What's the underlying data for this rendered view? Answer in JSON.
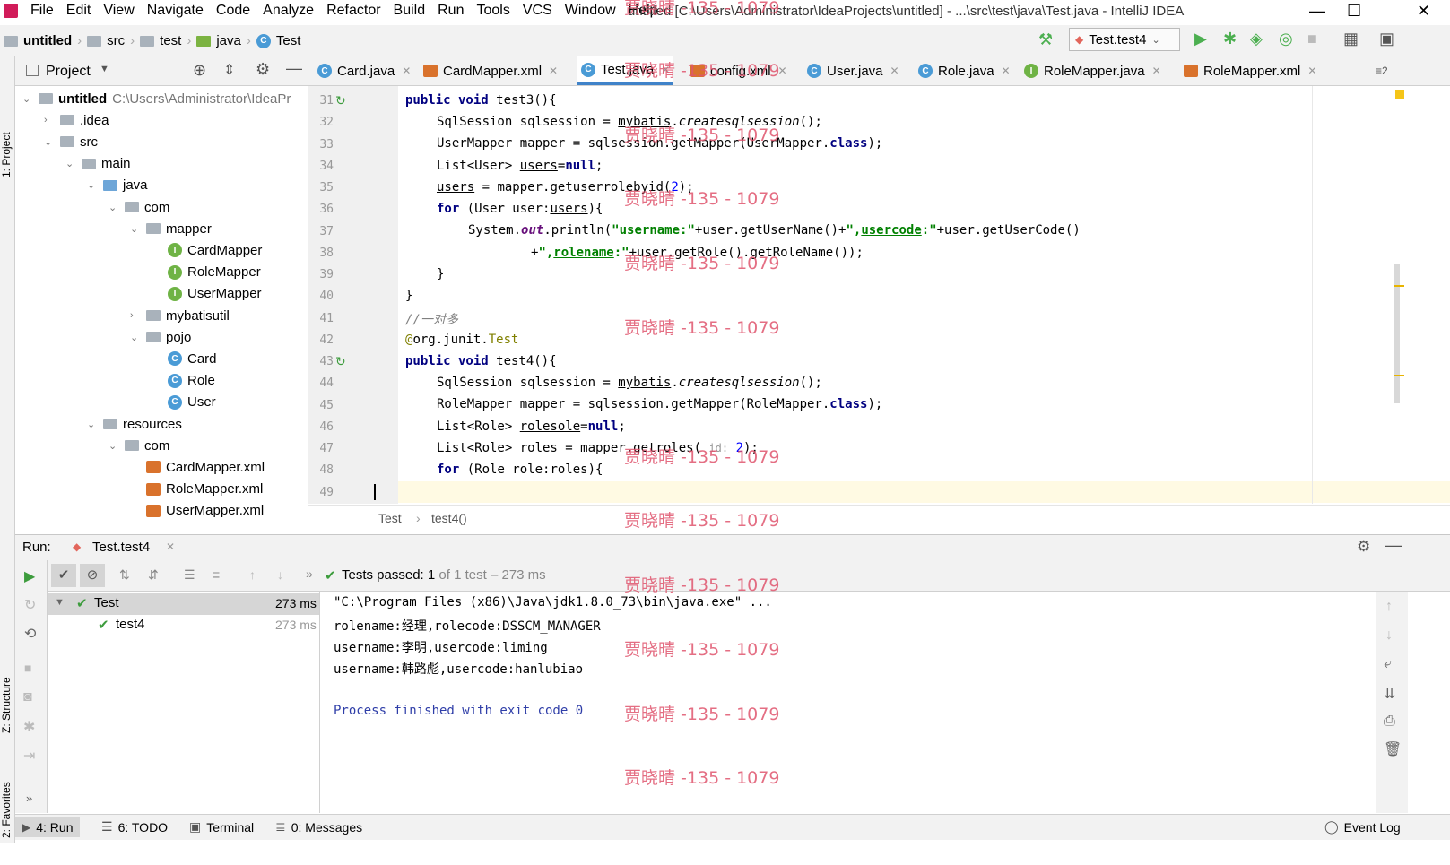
{
  "menubar": {
    "items": [
      "File",
      "Edit",
      "View",
      "Navigate",
      "Code",
      "Analyze",
      "Refactor",
      "Build",
      "Run",
      "Tools",
      "VCS",
      "Window",
      "Help"
    ],
    "title": "untitled [C:\\Users\\Administrator\\IdeaProjects\\untitled] - ...\\src\\test\\java\\Test.java - IntelliJ IDEA"
  },
  "navbar": {
    "crumbs": [
      "untitled",
      "src",
      "test",
      "java",
      "Test"
    ],
    "run_config": "Test.test4"
  },
  "left_strip": {
    "project": "1: Project",
    "structure": "Z: Structure",
    "favorites": "2: Favorites"
  },
  "project": {
    "header": "Project",
    "tree": [
      {
        "label": "untitled",
        "extra": "C:\\Users\\Administrator\\IdeaPr",
        "icon": "folder",
        "depth": 0,
        "expanded": true
      },
      {
        "label": ".idea",
        "icon": "folder",
        "depth": 1,
        "expanded": false
      },
      {
        "label": "src",
        "icon": "folder",
        "depth": 1,
        "expanded": true
      },
      {
        "label": "main",
        "icon": "folder",
        "depth": 2,
        "expanded": true
      },
      {
        "label": "java",
        "icon": "folderb",
        "depth": 3,
        "expanded": true
      },
      {
        "label": "com",
        "icon": "folder",
        "depth": 4,
        "expanded": true
      },
      {
        "label": "mapper",
        "icon": "folder",
        "depth": 5,
        "expanded": true
      },
      {
        "label": "CardMapper",
        "icon": "interface",
        "depth": 6
      },
      {
        "label": "RoleMapper",
        "icon": "interface",
        "depth": 6
      },
      {
        "label": "UserMapper",
        "icon": "interface",
        "depth": 6
      },
      {
        "label": "mybatisutil",
        "icon": "folder",
        "depth": 5,
        "expanded": false
      },
      {
        "label": "pojo",
        "icon": "folder",
        "depth": 5,
        "expanded": true
      },
      {
        "label": "Card",
        "icon": "class",
        "depth": 6
      },
      {
        "label": "Role",
        "icon": "class",
        "depth": 6
      },
      {
        "label": "User",
        "icon": "class",
        "depth": 6
      },
      {
        "label": "resources",
        "icon": "folder",
        "depth": 3,
        "expanded": true
      },
      {
        "label": "com",
        "icon": "folder",
        "depth": 4,
        "expanded": true
      },
      {
        "label": "CardMapper.xml",
        "icon": "xml",
        "depth": 5
      },
      {
        "label": "RoleMapper.xml",
        "icon": "xml",
        "depth": 5
      },
      {
        "label": "UserMapper.xml",
        "icon": "xml",
        "depth": 5
      }
    ]
  },
  "tabs": [
    {
      "label": "Card.java",
      "icon": "class"
    },
    {
      "label": "CardMapper.xml",
      "icon": "xml"
    },
    {
      "label": "Test.java",
      "icon": "class",
      "active": true
    },
    {
      "label": "config.xml",
      "icon": "xml"
    },
    {
      "label": "User.java",
      "icon": "class"
    },
    {
      "label": "Role.java",
      "icon": "class"
    },
    {
      "label": "RoleMapper.java",
      "icon": "interface"
    },
    {
      "label": "RoleMapper.xml",
      "icon": "xml"
    }
  ],
  "tabs_overflow": "≡2",
  "editor": {
    "line_numbers": [
      "31",
      "32",
      "33",
      "34",
      "35",
      "36",
      "37",
      "38",
      "39",
      "40",
      "41",
      "42",
      "43",
      "44",
      "45",
      "46",
      "47",
      "48",
      "49"
    ],
    "param_hint": "id:",
    "breadcrumb": [
      "Test",
      "test4()"
    ]
  },
  "run": {
    "label": "Run:",
    "tab": "Test.test4",
    "tests_passed": "Tests passed:",
    "passed_count": "1",
    "passed_rest": "of 1 test – 273 ms",
    "tree": [
      {
        "label": "Test",
        "time": "273 ms"
      },
      {
        "label": "test4",
        "time": "273 ms"
      }
    ],
    "console": [
      "\"C:\\Program Files (x86)\\Java\\jdk1.8.0_73\\bin\\java.exe\" ...",
      "rolename:经理,rolecode:DSSCM_MANAGER",
      "username:李明,usercode:liming",
      "username:韩路彪,usercode:hanlubiao",
      "",
      "Process finished with exit code 0"
    ]
  },
  "statusbar": {
    "run": "4: Run",
    "todo": "6: TODO",
    "terminal": "Terminal",
    "messages": "0: Messages",
    "eventlog": "Event Log"
  },
  "watermark": "贾晓晴 -135 - 1079",
  "colors": {
    "accent": "#4083c9",
    "passed": "#3d9c3d",
    "keyword": "#000080",
    "string": "#008000",
    "watermark": "#e0556e"
  }
}
